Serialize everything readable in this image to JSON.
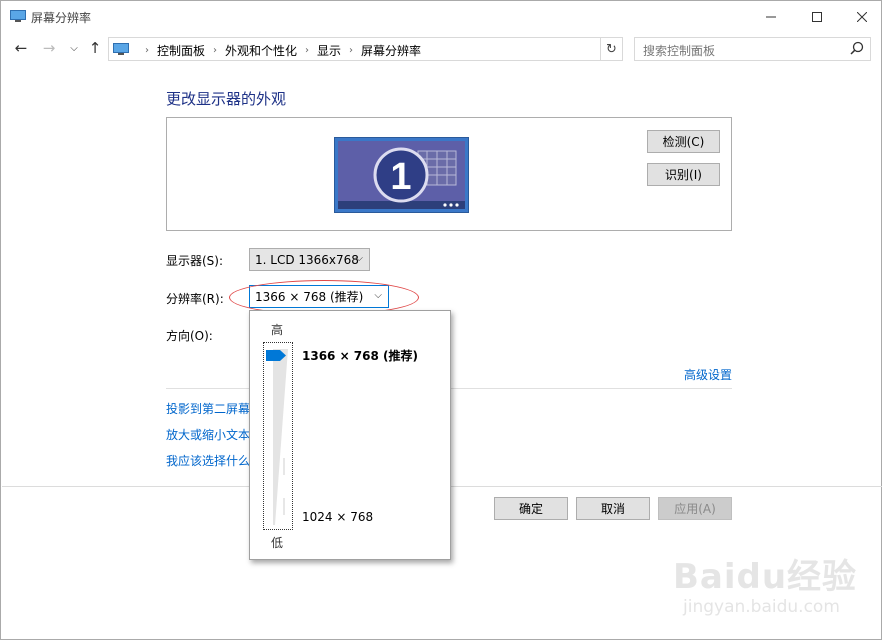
{
  "window": {
    "title": "屏幕分辨率",
    "minimize_icon": "minimize-icon",
    "maximize_icon": "maximize-icon",
    "close_icon": "close-icon"
  },
  "navigation": {
    "breadcrumbs": [
      "控制面板",
      "外观和个性化",
      "显示",
      "屏幕分辨率"
    ],
    "search_placeholder": "搜索控制面板"
  },
  "main": {
    "heading": "更改显示器的外观",
    "monitor_number": "1",
    "detect_button": "检测(C)",
    "identify_button": "识别(I)",
    "display_label": "显示器(S):",
    "display_value": "1. LCD 1366x768",
    "resolution_label": "分辨率(R):",
    "resolution_value": "1366 × 768 (推荐)",
    "orientation_label": "方向(O):",
    "advanced_link": "高级设置",
    "links": [
      "投影到第二屏幕",
      "放大或缩小文本",
      "我应该选择什么"
    ]
  },
  "resolution_dropdown": {
    "high_label": "高",
    "low_label": "低",
    "max_option": "1366 × 768 (推荐)",
    "min_option": "1024 × 768",
    "slider_level": 1.0
  },
  "footer": {
    "ok_button": "确定",
    "cancel_button": "取消",
    "apply_button": "应用(A)"
  },
  "watermark": {
    "brand": "Baidu经验",
    "site": "jingyan.baidu.com"
  },
  "colors": {
    "heading": "#1e3287",
    "link": "#0066cc",
    "accent": "#0078d7",
    "highlight_oval": "#e04848"
  }
}
